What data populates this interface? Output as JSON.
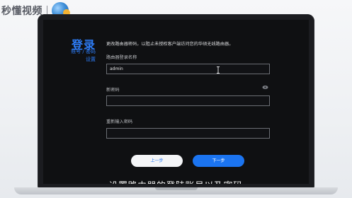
{
  "watermark": {
    "brand_text": "秒懂视频"
  },
  "page": {
    "title": "登录",
    "subtitle_line1": "账号 / 密码",
    "subtitle_line2": "设置",
    "description": "更改路由器密码，以阻止未授权客户端访问您的华硕无线路由器。"
  },
  "form": {
    "username_label": "路由器登录名称",
    "username_value": "admin",
    "new_password_label": "新密码",
    "new_password_value": "",
    "confirm_password_label": "重新输入密码",
    "confirm_password_value": ""
  },
  "buttons": {
    "prev_label": "上一步",
    "next_label": "下一步"
  },
  "caption": "设置路由器的登陆账号以及密码",
  "colors": {
    "accent": "#2d7cf6",
    "primary_button": "#1b74f0",
    "screen_bg": "#0f1012"
  },
  "icons": {
    "text_cursor": "text-cursor-icon",
    "show_password": "eye-icon",
    "brand_logo": "brand-logo-icon"
  }
}
